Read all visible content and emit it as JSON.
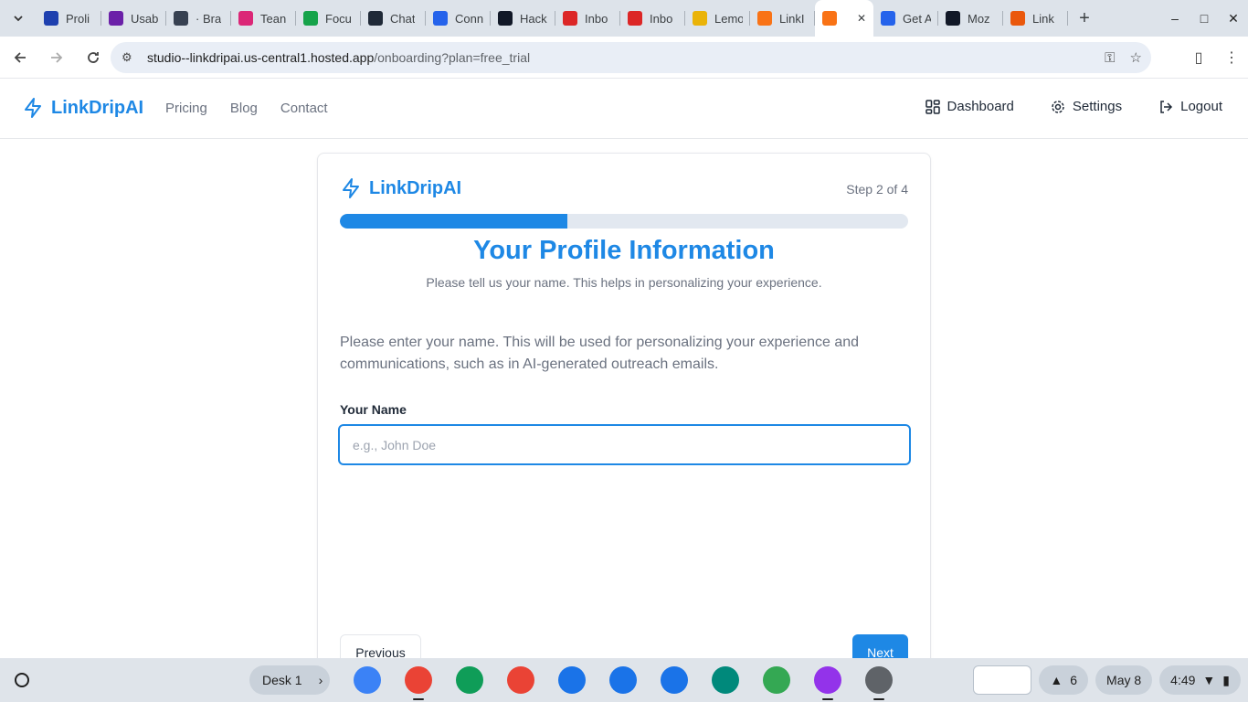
{
  "browser": {
    "tabs": [
      {
        "label": "Proli",
        "icon": "waves-icon",
        "color": "#1e40af"
      },
      {
        "label": "Usab",
        "icon": "list-icon",
        "color": "#6b21a8"
      },
      {
        "label": "· Bra",
        "icon": "globe-icon",
        "color": "#374151"
      },
      {
        "label": "Tean",
        "icon": "search-person-icon",
        "color": "#db2777"
      },
      {
        "label": "Focu",
        "icon": "doc-icon",
        "color": "#16a34a"
      },
      {
        "label": "Chat",
        "icon": "react-icon",
        "color": "#1f2937"
      },
      {
        "label": "Conn",
        "icon": "link-icon",
        "color": "#2563eb"
      },
      {
        "label": "Hack",
        "icon": "b-icon",
        "color": "#111827"
      },
      {
        "label": "Inbo",
        "icon": "gmail-icon",
        "color": "#dc2626"
      },
      {
        "label": "Inbo",
        "icon": "gmail-icon",
        "color": "#dc2626"
      },
      {
        "label": "Lemo",
        "icon": "lemon-icon",
        "color": "#eab308"
      },
      {
        "label": "LinkI",
        "icon": "firebase-icon",
        "color": "#f97316"
      },
      {
        "label": "",
        "icon": "app-icon",
        "color": "#f97316",
        "active": true
      },
      {
        "label": "Get A",
        "icon": "butterfly-icon",
        "color": "#2563eb"
      },
      {
        "label": "Moz",
        "icon": "m-icon",
        "color": "#111827"
      },
      {
        "label": "Link",
        "icon": "nodes-icon",
        "color": "#ea580c"
      }
    ],
    "url_host": "studio--linkdripai.us-central1.hosted.app",
    "url_path": "/onboarding?plan=free_trial"
  },
  "app_nav": {
    "brand": "LinkDripAI",
    "links": [
      "Pricing",
      "Blog",
      "Contact"
    ],
    "right": [
      {
        "label": "Dashboard",
        "icon": "grid-icon"
      },
      {
        "label": "Settings",
        "icon": "gear-icon"
      },
      {
        "label": "Logout",
        "icon": "logout-icon"
      }
    ]
  },
  "onboarding": {
    "brand": "LinkDripAI",
    "step_text": "Step 2 of 4",
    "progress_fraction": 0.4,
    "title": "Your Profile Information",
    "subtitle": "Please tell us your name. This helps in personalizing your experience.",
    "description": "Please enter your name. This will be used for personalizing your experience and communications, such as in AI-generated outreach emails.",
    "name_label": "Your Name",
    "name_placeholder": "e.g., John Doe",
    "name_value": "",
    "previous_label": "Previous",
    "next_label": "Next",
    "accent_color": "#1e88e5"
  },
  "shelf": {
    "desk_label": "Desk 1",
    "apps": [
      {
        "name": "gemini-icon",
        "color": "#3b82f6"
      },
      {
        "name": "chrome-icon",
        "color": "#ea4335",
        "running": true
      },
      {
        "name": "workspace-icon",
        "color": "#0f9d58"
      },
      {
        "name": "gmail-icon",
        "color": "#ea4335"
      },
      {
        "name": "calendar-icon",
        "color": "#1a73e8"
      },
      {
        "name": "files-icon",
        "color": "#1a73e8"
      },
      {
        "name": "messages-icon",
        "color": "#1a73e8"
      },
      {
        "name": "meet-icon",
        "color": "#00897b"
      },
      {
        "name": "play-store-icon",
        "color": "#34a853"
      },
      {
        "name": "screencast-icon",
        "color": "#9333ea",
        "running": true
      },
      {
        "name": "settings-icon",
        "color": "#5f6368",
        "running": true
      }
    ],
    "notification_count": "6",
    "date": "May 8",
    "time": "4:49"
  }
}
